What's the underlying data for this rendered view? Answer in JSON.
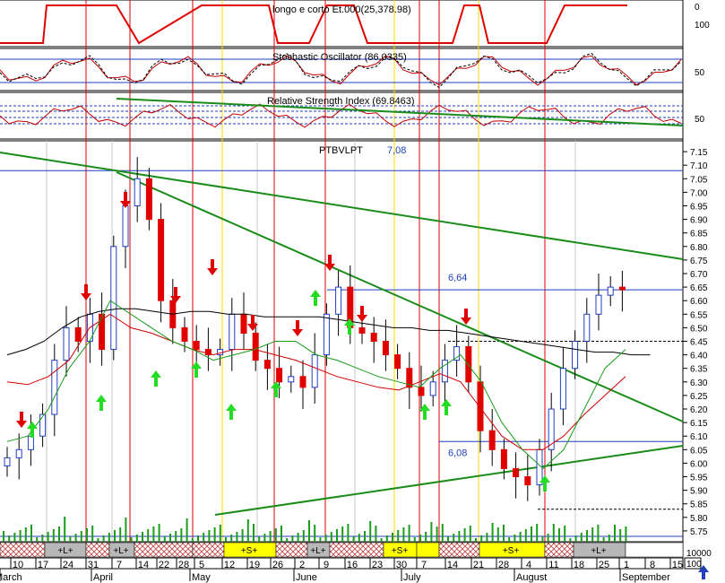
{
  "chart_data": {
    "type": "candlestick",
    "ticker": "PTBVLPT",
    "last_value_label": "7,08",
    "panels": {
      "position_indicator": {
        "label": "longo e corto Et.000(25,378.98)",
        "axis_ticks": [
          "0",
          "100"
        ]
      },
      "stochastic": {
        "label": "Stochastic Oscillator (86.0335)",
        "axis_ticks": [
          "50"
        ]
      },
      "rsi": {
        "label": "Relative Strength Index (69.8463)",
        "axis_ticks": [
          "50"
        ]
      },
      "price": {
        "ylim": [
          5.71,
          7.19
        ],
        "y_ticks": [
          "7.15",
          "7.10",
          "7.05",
          "7.00",
          "6.95",
          "6.90",
          "6.85",
          "6.80",
          "6.75",
          "6.70",
          "6.65",
          "6.60",
          "6.55",
          "6.50",
          "6.45",
          "6.40",
          "6.35",
          "6.30",
          "6.25",
          "6.20",
          "6.15",
          "6.10",
          "6.05",
          "6.00",
          "5.95",
          "5.90",
          "5.85",
          "5.80",
          "5.75"
        ],
        "annotations": [
          {
            "text": "6,64",
            "value": 6.64
          },
          {
            "text": "6,08",
            "value": 6.08
          }
        ]
      },
      "volume": {
        "axis_ticks": [
          "10000",
          "100"
        ]
      }
    },
    "signal_bar": [
      "+L+",
      "+L+",
      "+S+",
      "+L+",
      "+S+",
      "+S+",
      "+L+"
    ],
    "x_day_labels": [
      "10",
      "17",
      "24",
      "31",
      "7",
      "14",
      "22",
      "28",
      "5",
      "12",
      "19",
      "26",
      "2",
      "9",
      "16",
      "23",
      "30",
      "7",
      "14",
      "21",
      "28",
      "4",
      "11",
      "18",
      "25",
      "1",
      "8",
      "15"
    ],
    "x_month_labels": [
      "March",
      "April",
      "May",
      "June",
      "July",
      "August",
      "September"
    ],
    "close_series": [
      6.02,
      6.05,
      6.1,
      6.18,
      6.38,
      6.5,
      6.45,
      6.55,
      6.42,
      6.8,
      6.95,
      7.05,
      6.9,
      6.6,
      6.5,
      6.45,
      6.42,
      6.4,
      6.42,
      6.55,
      6.48,
      6.38,
      6.35,
      6.3,
      6.32,
      6.28,
      6.4,
      6.55,
      6.65,
      6.5,
      6.48,
      6.45,
      6.4,
      6.35,
      6.28,
      6.25,
      6.3,
      6.38,
      6.43,
      6.3,
      6.12,
      6.05,
      5.98,
      5.95,
      5.92,
      6.05,
      6.2,
      6.35,
      6.45,
      6.55,
      6.62,
      6.65,
      6.64
    ],
    "moving_average_long": [
      6.4,
      6.42,
      6.45,
      6.5,
      6.54,
      6.56,
      6.57,
      6.57,
      6.56,
      6.55,
      6.56,
      6.56,
      6.55,
      6.55,
      6.54,
      6.54,
      6.54,
      6.54,
      6.53,
      6.52,
      6.51,
      6.5,
      6.5,
      6.49,
      6.49,
      6.48,
      6.47,
      6.46,
      6.45,
      6.44,
      6.43,
      6.42,
      6.41,
      6.41,
      6.4,
      6.4
    ],
    "moving_average_mid": [
      6.3,
      6.29,
      6.32,
      6.38,
      6.5,
      6.55,
      6.5,
      6.48,
      6.45,
      6.42,
      6.4,
      6.42,
      6.42,
      6.4,
      6.38,
      6.35,
      6.32,
      6.3,
      6.28,
      6.27,
      6.3,
      6.33,
      6.3,
      6.2,
      6.1,
      6.05,
      6.05,
      6.1,
      6.18,
      6.25,
      6.32
    ],
    "moving_average_short": [
      6.08,
      6.1,
      6.2,
      6.35,
      6.45,
      6.6,
      6.55,
      6.5,
      6.45,
      6.42,
      6.38,
      6.4,
      6.42,
      6.45,
      6.45,
      6.4,
      6.38,
      6.35,
      6.32,
      6.3,
      6.28,
      6.35,
      6.4,
      6.3,
      6.15,
      6.05,
      5.98,
      6.05,
      6.2,
      6.35,
      6.42
    ]
  }
}
